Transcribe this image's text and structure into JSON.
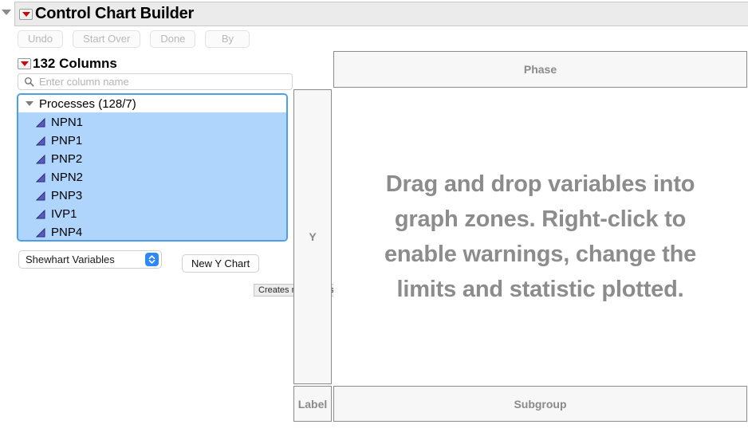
{
  "window": {
    "title": "Control Chart Builder",
    "twisty_icon": "disclosure-triangle-icon",
    "red_twisty_icon": "red-disclosure-triangle-icon"
  },
  "toolbar": {
    "buttons": [
      {
        "label": "Undo"
      },
      {
        "label": "Start Over"
      },
      {
        "label": "Done"
      },
      {
        "label": "By"
      }
    ]
  },
  "columns_panel": {
    "count_label": "132 Columns",
    "search": {
      "placeholder": "Enter column name",
      "value": "",
      "icon": "search-icon"
    },
    "group": {
      "label": "Processes (128/7)",
      "caret_icon": "triangle-down-icon"
    },
    "items": [
      {
        "label": "NPN1",
        "icon": "continuous-variable-icon"
      },
      {
        "label": "PNP1",
        "icon": "continuous-variable-icon"
      },
      {
        "label": "PNP2",
        "icon": "continuous-variable-icon"
      },
      {
        "label": "NPN2",
        "icon": "continuous-variable-icon"
      },
      {
        "label": "PNP3",
        "icon": "continuous-variable-icon"
      },
      {
        "label": "IVP1",
        "icon": "continuous-variable-icon"
      },
      {
        "label": "PNP4",
        "icon": "continuous-variable-icon"
      }
    ],
    "selection_color": "#b0d5fd",
    "focus_border_color": "#4a9eea"
  },
  "controls": {
    "statistic_select": {
      "value": "Shewhart Variables",
      "stepper_icon": "up-down-chevron-icon",
      "stepper_color": "#2f88f7"
    },
    "new_y_chart_button": "New Y Chart",
    "tooltip": "Creates new charts for all selected columns."
  },
  "zones": {
    "phase": "Phase",
    "y": "Y",
    "label": "Label",
    "subgroup": "Subgroup",
    "drop_message": "Drag and drop variables into graph zones. Right-click to enable warnings, change the limits and statistic plotted."
  }
}
